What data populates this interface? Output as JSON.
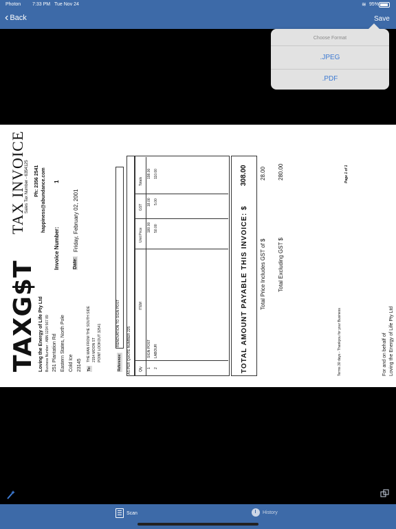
{
  "status": {
    "left": "Photon",
    "time": "7:33 PM",
    "date": "Tue Nov 24",
    "battery": "95%"
  },
  "nav": {
    "back": "Back",
    "save": "Save"
  },
  "format_menu": {
    "title": "Choose Format",
    "options": [
      ".JPEG",
      ".PDF"
    ]
  },
  "invoice": {
    "logo": "TAXG$T",
    "title": "TAX INVOICE",
    "company": "Loving the Energy of Life Pty Ltd",
    "abn": "Business Number : ABN 1234 567 89",
    "address": [
      "251 Plantation Rd",
      "Eastern States, North Pole",
      "Cold Ice",
      "23145"
    ],
    "sales_tax": "Sales Tax Number - 6354125",
    "phone": "Ph: 2356 2541",
    "email": "happiness@abundance.com",
    "invoice_number_label": "Invoice Number:",
    "invoice_number": "1",
    "date_label": "Date:",
    "date": "Friday, February 02, 2001",
    "to_label": "To:",
    "to": [
      "THE MAN FROM THE SOUTH SIDE",
      "2154 MOON ST",
      "POINT LOOKOUT 32541"
    ],
    "reference_label": "Reference:",
    "reference": "RENOVATION TO SIGN POST",
    "quote": "AS PER QUOTE NUMBER 225",
    "table_headers": {
      "qty": "Qty",
      "item": "ITEM",
      "unit_price": "Unit Price",
      "gst": "GST",
      "totals": "Totals"
    },
    "rows": [
      {
        "qty": "1",
        "item": "SIGN POST",
        "unit_price": "180.00",
        "gst": "18.00",
        "total": "198.00"
      },
      {
        "qty": "2",
        "item": "LABOUR",
        "unit_price": "50.00",
        "gst": "5.00",
        "total": "110.00"
      }
    ],
    "total_label": "TOTAL AMOUNT PAYABLE THIS INVOICE: $",
    "total": "308.00",
    "gst_label": "Total Price Includes GST of $",
    "gst_total": "28.00",
    "excl_label": "Total Excluding GST $",
    "excl_total": "280.00",
    "terms": "Terms 30 days - Thankyou for your Business",
    "page": "Page 1 of 1",
    "behalf": [
      "For and on behalf of",
      "Loving the Energy of Life Pty Ltd"
    ]
  },
  "tabs": {
    "scan": "Scan",
    "history": "History"
  },
  "icons": {
    "wand": "magic-wand-icon",
    "crop": "crop-icon",
    "scan": "scan-icon",
    "history": "clock-icon"
  },
  "colors": {
    "accent": "#3d6aa8",
    "link": "#3d7ad2"
  }
}
